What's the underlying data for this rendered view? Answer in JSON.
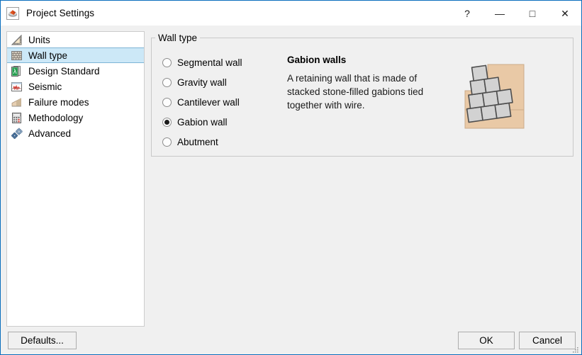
{
  "window": {
    "title": "Project Settings",
    "app_icon": "application-icon",
    "accent": "#0a6ebd",
    "background": "#f0f0f0",
    "controls": [
      {
        "name": "help-button",
        "glyph": "?"
      },
      {
        "name": "minimize-button",
        "glyph": "—"
      },
      {
        "name": "maximize-button",
        "glyph": "□"
      },
      {
        "name": "close-button",
        "glyph": "✕"
      }
    ]
  },
  "sidebar": {
    "selected_index": 1,
    "selection_color": "#cce8f7",
    "items": [
      {
        "label": "Units",
        "icon": "ruler-triangle-icon"
      },
      {
        "label": "Wall type",
        "icon": "brick-wall-icon"
      },
      {
        "label": "Design Standard",
        "icon": "document-standard-icon"
      },
      {
        "label": "Seismic",
        "icon": "seismic-waveform-icon"
      },
      {
        "label": "Failure modes",
        "icon": "slope-wedge-icon"
      },
      {
        "label": "Methodology",
        "icon": "calculator-icon"
      },
      {
        "label": "Advanced",
        "icon": "gears-icon"
      }
    ]
  },
  "main": {
    "group_title": "Wall type",
    "wall_types": [
      {
        "label": "Segmental wall",
        "checked": false
      },
      {
        "label": "Gravity wall",
        "checked": false
      },
      {
        "label": "Cantilever wall",
        "checked": false
      },
      {
        "label": "Gabion wall",
        "checked": true
      },
      {
        "label": "Abutment",
        "checked": false
      }
    ],
    "description": {
      "heading": "Gabion walls",
      "body": "A retaining wall that is made of stacked stone-filled gabions tied together with wire."
    },
    "illustration": {
      "name": "gabion-wall-diagram",
      "soil_color": "#e9c9a6",
      "soil_light_color": "#f0d7bc",
      "block_color": "#d2d2d2",
      "block_outline": "#4d4d4d"
    }
  },
  "footer": {
    "defaults_label": "Defaults...",
    "ok_label": "OK",
    "cancel_label": "Cancel"
  }
}
